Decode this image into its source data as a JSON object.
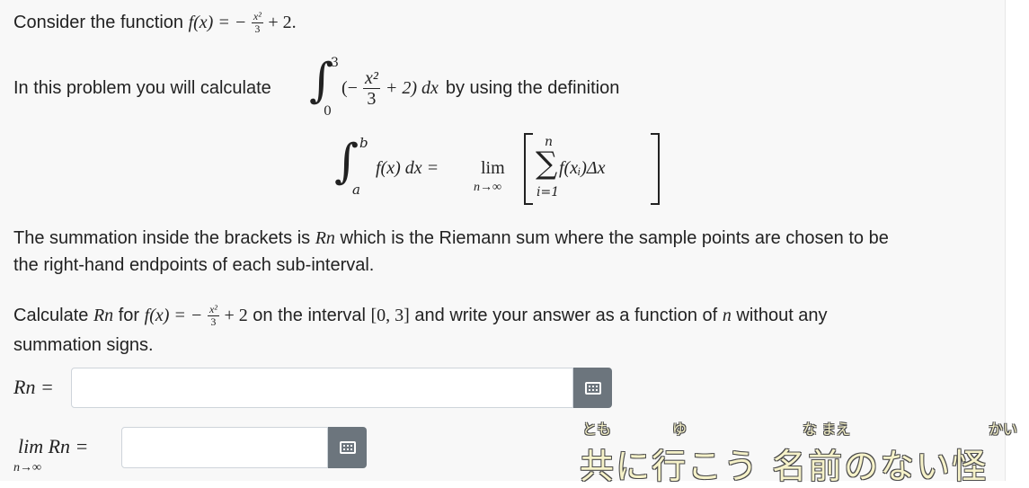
{
  "problem": {
    "intro_text": "Consider the function",
    "intro_func_lhs": "f(x) = −",
    "intro_frac_num": "x²",
    "intro_frac_den": "3",
    "intro_func_rhs": "+ 2.",
    "calc_prefix": "In this problem you will calculate",
    "integral_upper": "3",
    "integral_lower": "0",
    "integrand_open": "(−",
    "integrand_num": "x²",
    "integrand_den": "3",
    "integrand_close": "+ 2) dx",
    "calc_suffix": "by using the definition",
    "def_lhs_upper": "b",
    "def_lhs_lower": "a",
    "def_integrand": "f(x) dx =",
    "def_lim": "lim",
    "def_lim_sub": "n→∞",
    "def_sum_top": "n",
    "def_sum_bottom": "i=1",
    "def_sum_body": "f(xᵢ)Δx",
    "summation_line1_a": "The summation inside the brackets is",
    "summation_Rn": "Rn",
    "summation_line1_b": "which is the Riemann sum where the sample points are chosen to be",
    "summation_line2": "the right-hand endpoints of each sub-interval.",
    "task_prefix": "Calculate",
    "task_Rn": "Rn",
    "task_for": "for",
    "task_func_lhs": "f(x) = −",
    "task_frac_num": "x²",
    "task_frac_den": "3",
    "task_func_rhs": "+ 2",
    "task_interval_text": "on the interval",
    "task_interval": "[0, 3]",
    "task_suffix": "and write your answer as a function of",
    "task_n": "n",
    "task_suffix2": "without any",
    "task_line2": "summation signs."
  },
  "answers": {
    "rn_label": "Rn =",
    "rn_value": "",
    "limit_label": "lim Rn =",
    "limit_sub": "n→∞",
    "limit_value": ""
  },
  "overlay": {
    "furigana_1": "とも",
    "furigana_2": "ゆ",
    "furigana_3": "な まえ",
    "furigana_4": "かい",
    "caption": "共に行こう 名前のない怪"
  },
  "colors": {
    "background": "#f8f8f8",
    "button": "#6c757d",
    "text": "#222222"
  }
}
